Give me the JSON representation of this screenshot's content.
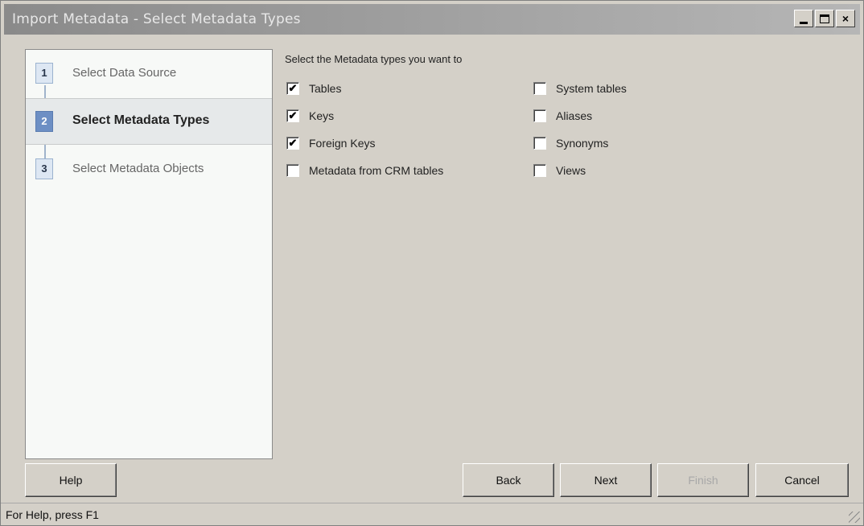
{
  "window": {
    "title": "Import Metadata - Select Metadata Types",
    "controls": {
      "minimize": "_",
      "maximize": "□",
      "close": "×"
    }
  },
  "steps": [
    {
      "number": "1",
      "label": "Select Data Source",
      "active": false
    },
    {
      "number": "2",
      "label": "Select Metadata Types",
      "active": true
    },
    {
      "number": "3",
      "label": "Select Metadata Objects",
      "active": false
    }
  ],
  "main": {
    "prompt": "Select the Metadata types you want to",
    "check_mark": "✔",
    "options_left": [
      {
        "label": "Tables",
        "checked": true
      },
      {
        "label": "Keys",
        "checked": true
      },
      {
        "label": "Foreign Keys",
        "checked": true
      },
      {
        "label": "Metadata from CRM tables",
        "checked": false
      }
    ],
    "options_right": [
      {
        "label": "System tables",
        "checked": false
      },
      {
        "label": "Aliases",
        "checked": false
      },
      {
        "label": "Synonyms",
        "checked": false
      },
      {
        "label": "Views",
        "checked": false
      }
    ]
  },
  "buttons": {
    "help": "Help",
    "back": "Back",
    "next": "Next",
    "finish": "Finish",
    "cancel": "Cancel"
  },
  "status": {
    "text": "For Help, press F1"
  }
}
